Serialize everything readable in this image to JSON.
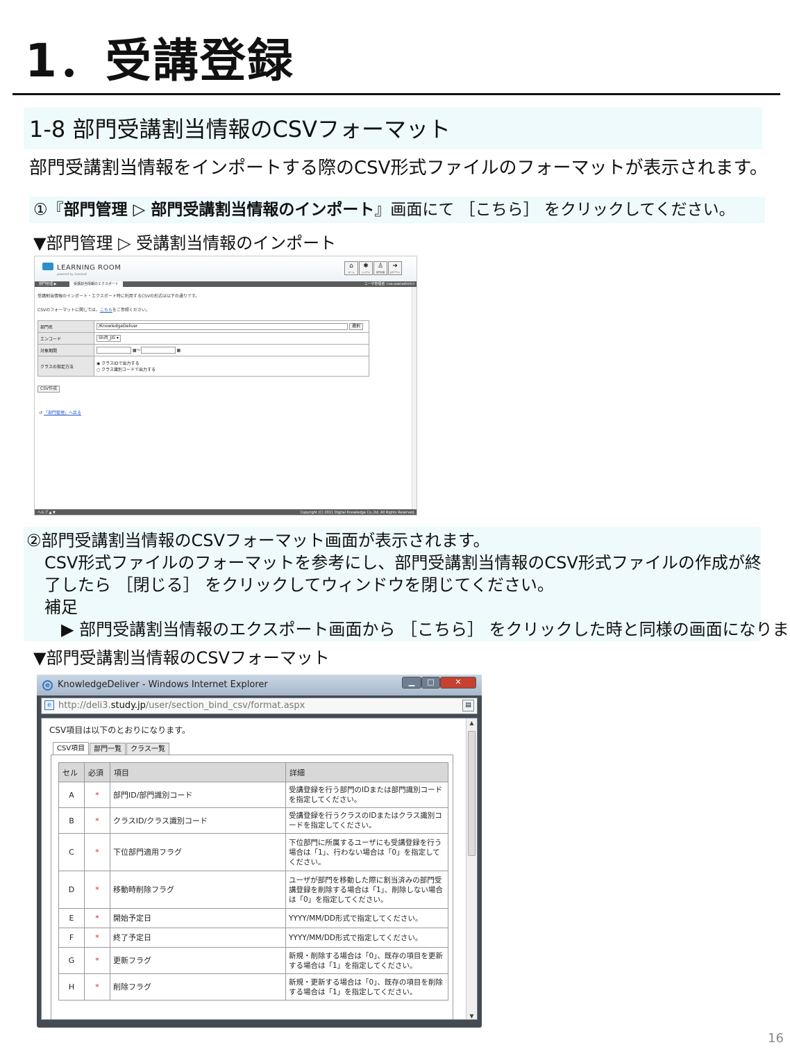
{
  "page": {
    "title": "1．受講登録",
    "number": "16"
  },
  "section": {
    "heading": "1-8  部門受講割当情報のCSVフォーマット",
    "lead": "部門受講割当情報をインポートする際のCSV形式ファイルのフォーマットが表示されます。"
  },
  "step1": {
    "prefix": "①『",
    "bold": "部門管理 ▷ 部門受講割当情報のインポート",
    "suffix": "』画面にて ［こちら］ をクリックしてください。",
    "caption": "▼部門管理  ▷  受講割当情報のインポート"
  },
  "screen1": {
    "logo": "LEARNING ROOM",
    "logo_sub": "powered by ricoomail",
    "toolbar": [
      {
        "icon": "home-icon",
        "glyph": "⌂",
        "label": "ホーム"
      },
      {
        "icon": "system-icon",
        "glyph": "✱",
        "label": "システム"
      },
      {
        "icon": "department-icon",
        "glyph": "♙",
        "label": "部門管理"
      },
      {
        "icon": "logout-icon",
        "glyph": "➜",
        "label": "ログアウト"
      }
    ],
    "crumb": "部門管理 ▶",
    "active_tab": "受講割当情報のエクスポート",
    "user": "ユーザ管理者 <ss-useradmin>",
    "desc1": "受講割当情報のインポート・エクスポート時に利用するCSVの形式は以下の通りです。",
    "desc2_prefix": "CSVのフォーマットに関しては、",
    "desc2_link": "こちら",
    "desc2_suffix": "をご参照ください。",
    "form": {
      "dept_label": "部門名",
      "dept_value": "/KnowledgeDeliver",
      "select_button": "選択",
      "encode_label": "エンコード",
      "encode_value": "Shift_JIS",
      "period_label": "対象期間",
      "period_sep": "〜",
      "class_label": "クラスの指定方法",
      "radio1": "クラスIDで出力する",
      "radio2": "クラス識別コードで出力する"
    },
    "csv_button": "CSV作成",
    "back_link": "「部門管理」へ戻る",
    "footer_left": "ヘルプ ▲ ▼",
    "footer_right": "Copyright (C) 2011 Digital Knowledge Co.,ltd. All Rights Reserved."
  },
  "step2": {
    "line1": "②部門受講割当情報のCSVフォーマット画面が表示されます。",
    "line2": "CSV形式ファイルのフォーマットを参考にし、部門受講割当情報のCSV形式ファイルの作成が終",
    "line3": "了したら ［閉じる］ をクリックしてウィンドウを閉じてください。",
    "line4": "補足",
    "line5": "▶ 部門受講割当情報のエクスポート画面から ［こちら］ をクリックした時と同様の画面になります。",
    "caption": "▼部門受講割当情報のCSVフォーマット"
  },
  "window": {
    "title": "KnowledgeDeliver - Windows Internet Explorer",
    "url_prefix": "http://deli3.",
    "url_domain": "study.jp",
    "url_path": "/user/section_bind_csv/format.aspx",
    "intro": "CSV項目は以下のとおりになります。",
    "tabs": [
      "CSV項目",
      "部門一覧",
      "クラス一覧"
    ],
    "headers": [
      "セル",
      "必須",
      "項目",
      "詳細"
    ],
    "rows": [
      {
        "cell": "A",
        "req": "*",
        "item": "部門ID/部門識別コード",
        "detail": "受講登録を行う部門のIDまたは部門識別コードを指定してください。"
      },
      {
        "cell": "B",
        "req": "*",
        "item": "クラスID/クラス識別コード",
        "detail": "受講登録を行うクラスのIDまたはクラス識別コードを指定してください。"
      },
      {
        "cell": "C",
        "req": "*",
        "item": "下位部門適用フラグ",
        "detail": "下位部門に所属するユーザにも受講登録を行う場合は「1」、行わない場合は「0」を指定してください。"
      },
      {
        "cell": "D",
        "req": "*",
        "item": "移動時削除フラグ",
        "detail": "ユーザが部門を移動した際に割当済みの部門受講登録を削除する場合は「1」、削除しない場合は「0」を指定してください。"
      },
      {
        "cell": "E",
        "req": "*",
        "item": "開始予定日",
        "detail": "YYYY/MM/DD形式で指定してください。"
      },
      {
        "cell": "F",
        "req": "*",
        "item": "終了予定日",
        "detail": "YYYY/MM/DD形式で指定してください。"
      },
      {
        "cell": "G",
        "req": "*",
        "item": "更新フラグ",
        "detail": "新規・削除する場合は「0」、既存の項目を更新する場合は「1」を指定してください。"
      },
      {
        "cell": "H",
        "req": "*",
        "item": "削除フラグ",
        "detail": "新規・更新する場合は「0」、既存の項目を削除する場合は「1」を指定してください。"
      }
    ]
  },
  "colors": {
    "band": "#eefafc",
    "required": "#dd2222",
    "dark_bar": "#5c5c5c",
    "close_button": "#c8402f"
  }
}
